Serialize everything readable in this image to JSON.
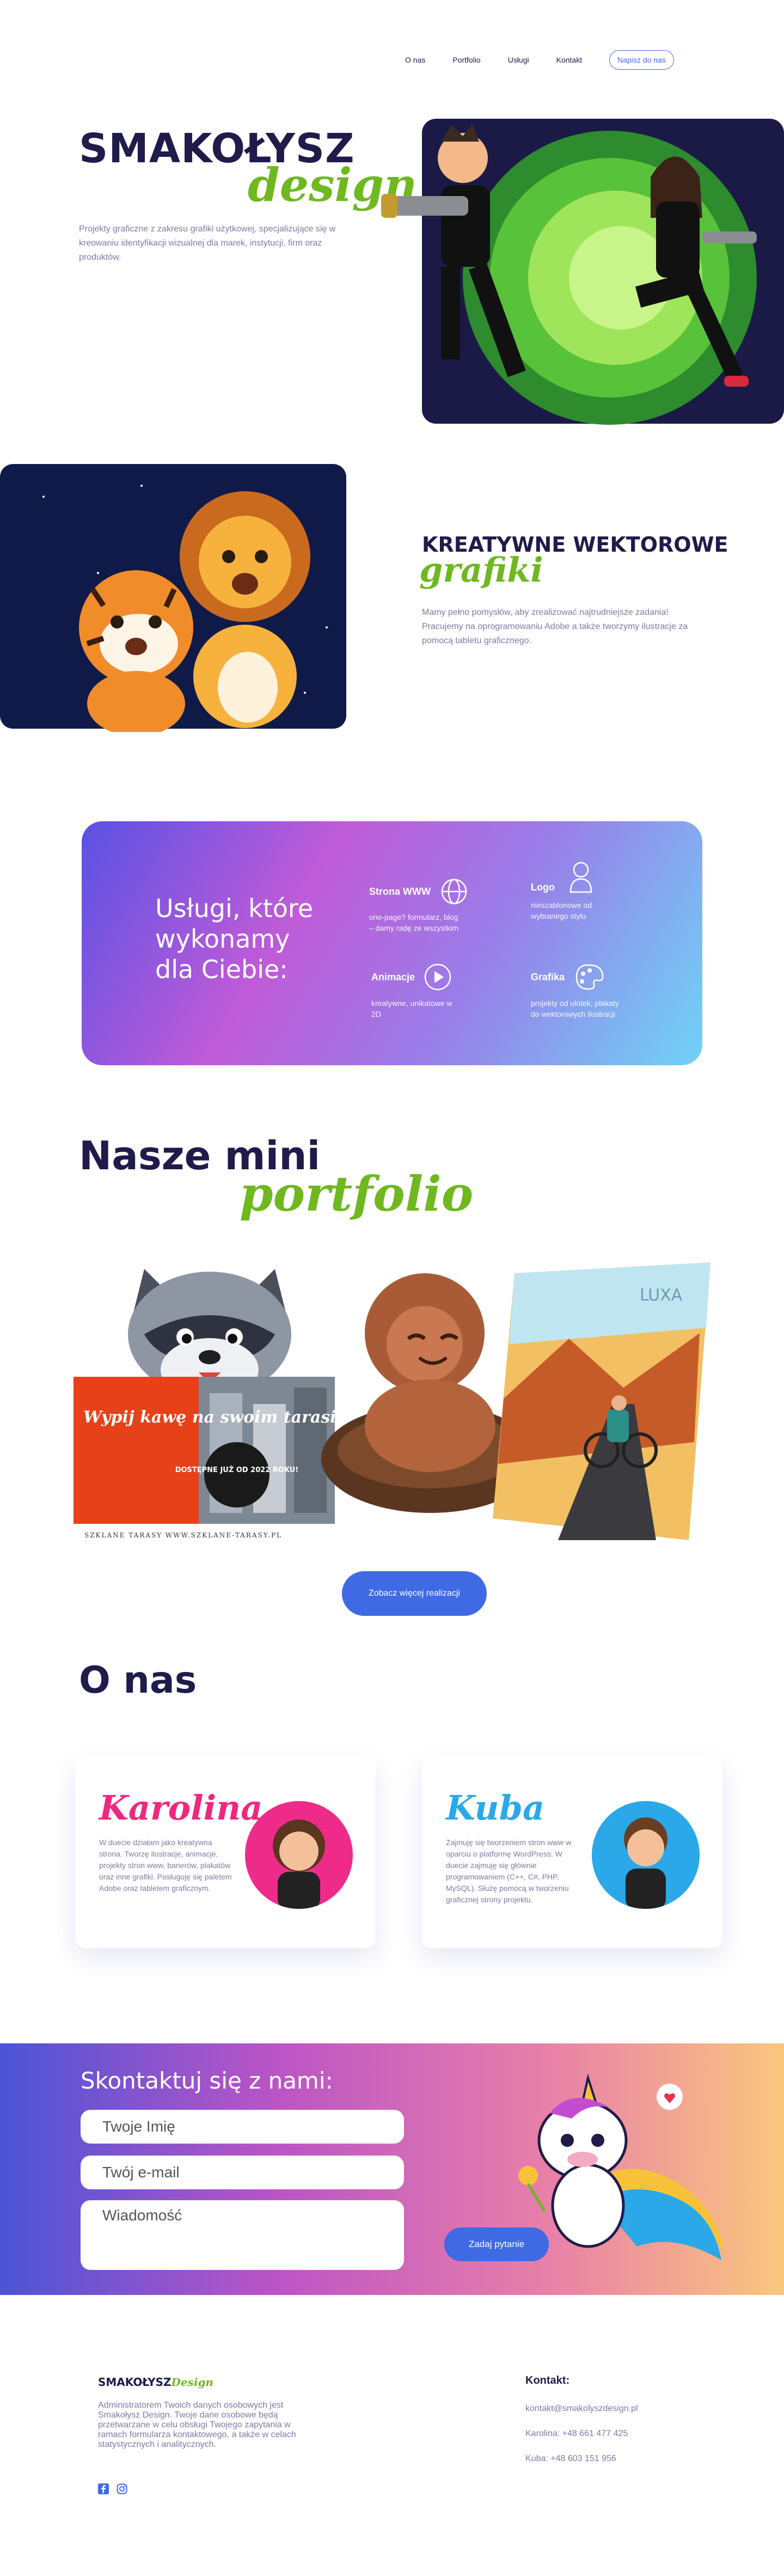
{
  "nav": {
    "items": [
      "O nas",
      "Portfolio",
      "Usługi",
      "Kontakt"
    ],
    "cta": "Napisz do nas"
  },
  "hero": {
    "logo_main": "SMAKOŁYSZ",
    "logo_sub": "design",
    "description": "Projekty graficzne z zakresu grafiki użytkowej, specjalizujące się w kreowaniu identyfikacji wizualnej dla marek, instytucji, firm oraz produktów."
  },
  "creative": {
    "title": "KREATYWNE WEKTOROWE",
    "subtitle": "grafiki",
    "description": "Mamy pełno pomysłów, aby zrealizować najtrudniejsze zadania! Pracujemy na oprogramowaniu Adobe a także tworzymy ilustracje za pomocą tabletu graficznego."
  },
  "services": {
    "title": "Usługi, które wykonamy dla Ciebie:",
    "items": [
      {
        "name": "Strona WWW",
        "desc": "one-page? formularz, blog – damy radę ze wszystkim",
        "icon": "globe-icon"
      },
      {
        "name": "Logo",
        "desc": "nieszablonowe od wybranego stylu",
        "icon": "user-icon"
      },
      {
        "name": "Animacje",
        "desc": "kreatywne, unikatowe w 2D",
        "icon": "play-icon"
      },
      {
        "name": "Grafika",
        "desc": "projekty od ulotek, plakaty do wektorowych ilustracji",
        "icon": "palette-icon"
      }
    ]
  },
  "portfolio": {
    "title": "Nasze mini",
    "subtitle": "portfolio",
    "poster_headline": "Wypij kawę na swoim tarasie!",
    "poster_badge": "DOSTĘPNE JUŻ OD 2022 ROKU!",
    "poster_footer": "SZKLANE TARASY    WWW.SZKLANE-TARASY.PL",
    "bike_logo": "LUXA",
    "cta": "Zobacz więcej realizacji"
  },
  "about": {
    "title": "O nas",
    "people": [
      {
        "name": "Karolina",
        "desc": "W duecie działam jako kreatywna strona. Tworzę ilustracje, animacje, projekty stron www, banerów, plakatów oraz inne grafiki. Posługuję się paletem Adobe oraz tabletem graficznym."
      },
      {
        "name": "Kuba",
        "desc": "Zajmuję się tworzeniem stron www w oparciu o platformę WordPress. W duecie zajmuję się głównie programowaniem (C++, C#, PHP, MySQL). Służę pomocą w tworzeniu graficznej strony projektu."
      }
    ]
  },
  "contact": {
    "title": "Skontaktuj się z nami:",
    "name_placeholder": "Twoje Imię",
    "email_placeholder": "Twój e-mail",
    "message_placeholder": "Wiadomość",
    "submit": "Zadaj pytanie"
  },
  "footer": {
    "logo_main": "SMAKOŁYSZ",
    "logo_sub": "Design",
    "description": "Administratorem Twoich danych osobowych jest Smakołysz Design. Twoje dane osobowe będą przetwarzane w celu obsługi Twojego zapytania w ramach formularza kontaktowego, a także w celach statystycznych i analitycznych.",
    "contact_title": "Kontakt:",
    "email": "kontakt@smakolyszdesign.pl",
    "phone1": "Karolina: +48 661 477 425",
    "phone2": "Kuba: +48 603 151 956"
  },
  "colors": {
    "accent": "#3f6ae4",
    "green": "#6fb820",
    "navy": "#1f1b4a",
    "pink": "#f0277e",
    "blue_name": "#2aa8e8"
  }
}
